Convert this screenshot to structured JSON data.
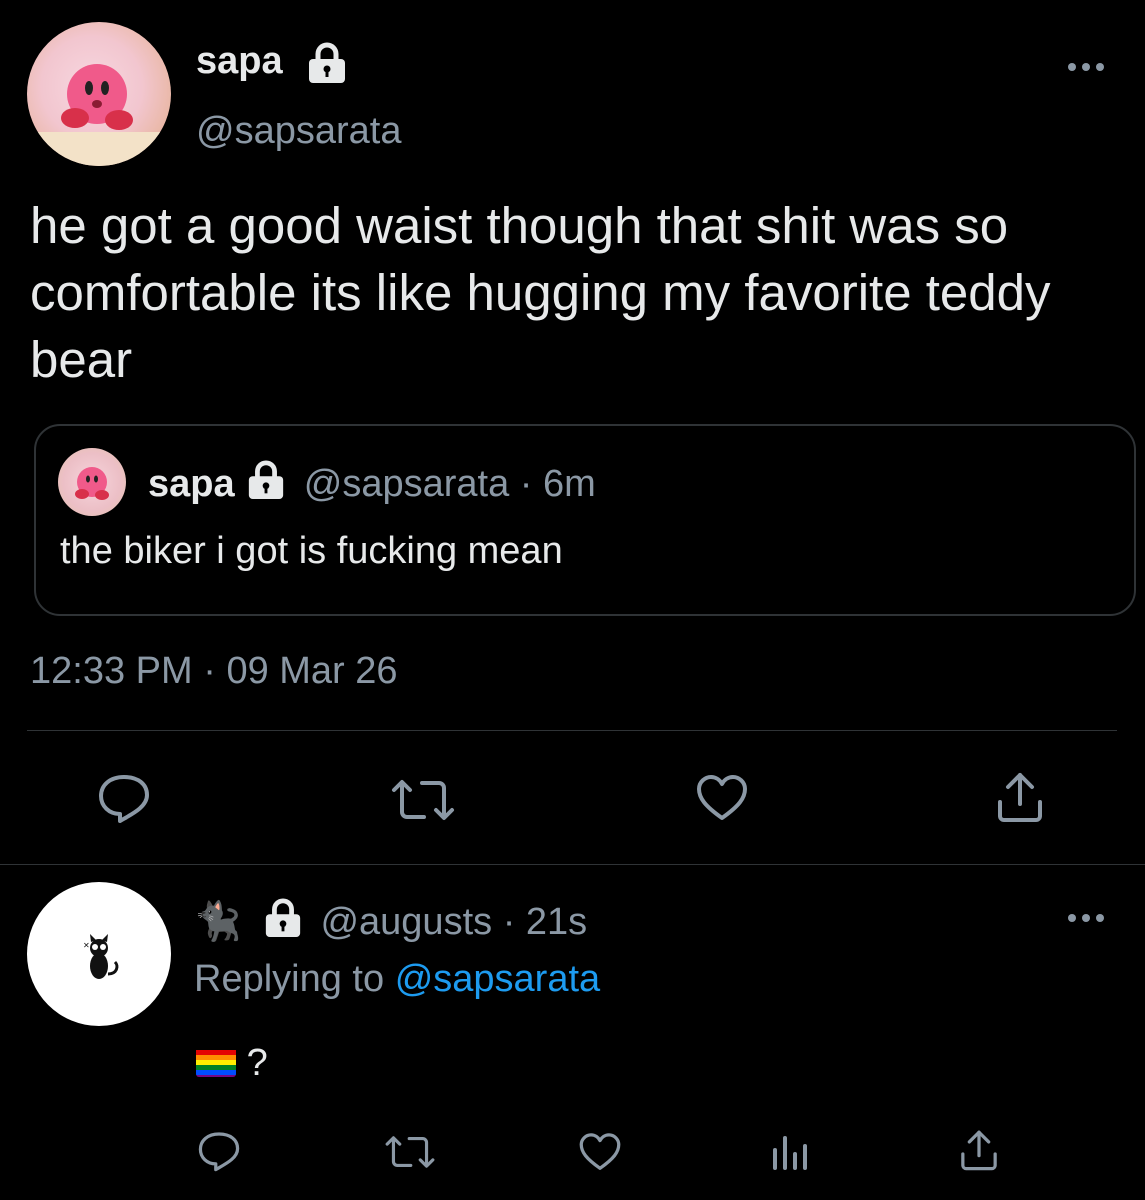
{
  "main_tweet": {
    "display_name": "sapa",
    "handle": "@sapsarata",
    "text": "he got a good waist though that shit was so comfortable its like hugging my favorite teddy bear",
    "time": "12:33 PM",
    "date": "09 Mar 26"
  },
  "quoted_tweet": {
    "display_name": "sapa",
    "handle": "@sapsarata",
    "time": "6m",
    "text": "the biker i got is fucking mean"
  },
  "reply": {
    "display_name_emoji": "🐈‍⬛",
    "handle": "@augusts",
    "time": "21s",
    "replying_to_label": "Replying to",
    "replying_to_handle": "@sapsarata",
    "text": "?"
  },
  "separator": "·",
  "colors": {
    "background": "#000000",
    "muted": "#8b98a5",
    "link": "#1d9bf0",
    "divider": "#2f3336"
  }
}
